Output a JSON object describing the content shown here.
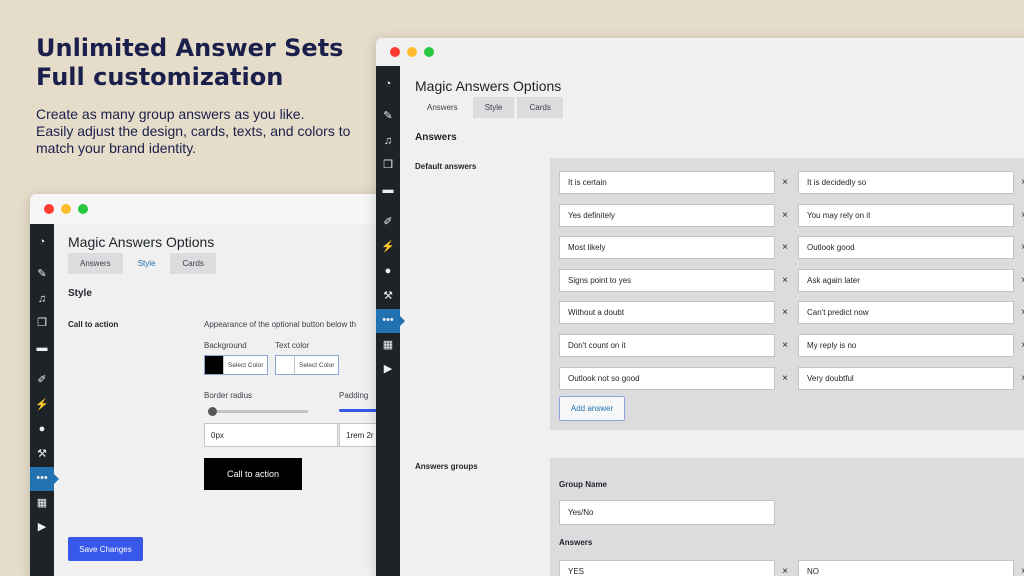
{
  "promo": {
    "headline_line1": "Unlimited Answer Sets",
    "headline_line2": "Full customization",
    "desc_line1": "Create as many group answers as you like.",
    "desc_line2": "Easily adjust the design, cards, texts, and colors to",
    "desc_line3": "match your brand identity."
  },
  "back_window": {
    "title": "Magic Answers Options",
    "tabs": [
      "Answers",
      "Style",
      "Cards"
    ],
    "active_tab": "Style",
    "section": "Style",
    "cta_label": "Call to action",
    "appearance_text": "Appearance of the optional button below th",
    "background_label": "Background",
    "text_color_label": "Text color",
    "select_color": "Select Color",
    "background_color": "#000000",
    "text_color": "#ffffff",
    "border_radius_label": "Border radius",
    "padding_label": "Padding",
    "border_radius_value": "0px",
    "padding_value": "1rem 2r",
    "border_radius_slider": 0,
    "cta_preview_text": "Call to action",
    "save_button": "Save Changes"
  },
  "front_window": {
    "title": "Magic Answers Options",
    "tabs": [
      "Answers",
      "Style",
      "Cards"
    ],
    "active_tab": "Answers",
    "section": "Answers",
    "default_answers_label": "Default answers",
    "answers_left": [
      "It is certain",
      "Yes definitely",
      "Most likely",
      "Signs point to yes",
      "Without a doubt",
      "Don't count on it",
      "Outlook not so good"
    ],
    "answers_right": [
      "It is decidedly so",
      "You may rely on it",
      "Outlook good",
      "Ask again later",
      "Can't predict now",
      "My reply is no",
      "Very doubtful"
    ],
    "remove_glyph": "×",
    "add_answer": "Add answer",
    "answers_groups_label": "Answers groups",
    "group_name_label": "Group Name",
    "group_name_value": "Yes/No",
    "group_answers_label": "Answers",
    "group_answers": [
      "YES",
      "NO"
    ]
  },
  "sidebar_icons": [
    "dashboard-icon",
    "pin-icon",
    "media-icon",
    "pages-icon",
    "comments-icon",
    "brush-icon",
    "plugins-icon",
    "users-icon",
    "tools-icon",
    "magic-answers-icon",
    "layout-icon",
    "play-icon"
  ],
  "colors": {
    "accent": "#3858e9",
    "sidebar": "#1d2327",
    "active_menu": "#2271b1",
    "headline": "#1a1f4b"
  }
}
